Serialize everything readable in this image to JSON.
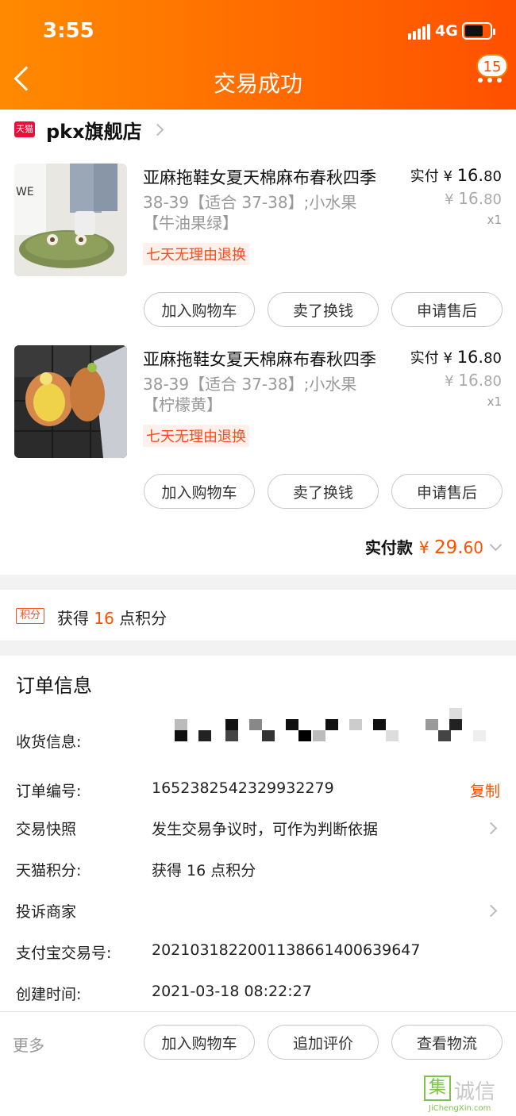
{
  "status_bar": {
    "time": "3:55",
    "network": "4G"
  },
  "header": {
    "title": "交易成功",
    "badge_count": "15"
  },
  "store": {
    "logo_text": "天猫",
    "name": "pkx旗舰店"
  },
  "items": [
    {
      "title": "亚麻拖鞋女夏天棉麻布春秋四季",
      "spec_line1": "38-39【适合 37-38】;小水果",
      "spec_line2": "【牛油果绿】",
      "tag": "七天无理由退换",
      "paid_label": "实付",
      "paid_currency": "¥",
      "paid_int": "16.",
      "paid_dec": "80",
      "orig_currency": "¥",
      "orig_int": "16.",
      "orig_dec": "80",
      "qty": "x1",
      "buttons": [
        "加入购物车",
        "卖了换钱",
        "申请售后"
      ]
    },
    {
      "title": "亚麻拖鞋女夏天棉麻布春秋四季",
      "spec_line1": "38-39【适合 37-38】;小水果",
      "spec_line2": "【柠檬黄】",
      "tag": "七天无理由退换",
      "paid_label": "实付",
      "paid_currency": "¥",
      "paid_int": "16.",
      "paid_dec": "80",
      "orig_currency": "¥",
      "orig_int": "16.",
      "orig_dec": "80",
      "qty": "x1",
      "buttons": [
        "加入购物车",
        "卖了换钱",
        "申请售后"
      ]
    }
  ],
  "total": {
    "label": "实付款",
    "currency": "¥",
    "int": "29.",
    "dec": "60"
  },
  "points": {
    "tag": "积分",
    "prefix": "获得",
    "num": "16",
    "suffix": "点积分"
  },
  "order_info": {
    "title": "订单信息",
    "shipping_label": "收货信息:",
    "order_no_label": "订单编号:",
    "order_no": "1652382542329932279",
    "copy_label": "复制",
    "snapshot_label": "交易快照",
    "snapshot_value": "发生交易争议时，可作为判断依据",
    "tmall_points_label": "天猫积分:",
    "tmall_points_value": "获得 16 点积分",
    "complain_label": "投诉商家",
    "alipay_label": "支付宝交易号:",
    "alipay_value": "2021031822001138661400639647",
    "created_label": "创建时间:",
    "created_value": "2021-03-18 08:22:27"
  },
  "bottom_bar": {
    "more_label": "更多",
    "buttons": [
      "加入购物车",
      "追加评价",
      "查看物流"
    ]
  },
  "watermark": {
    "box_char": "集",
    "text": "诚信",
    "sub": "JiChengXin.com"
  },
  "colors": {
    "accent": "#ff5000",
    "header_start": "#ff8a00",
    "tmall_red": "#e8103a"
  }
}
